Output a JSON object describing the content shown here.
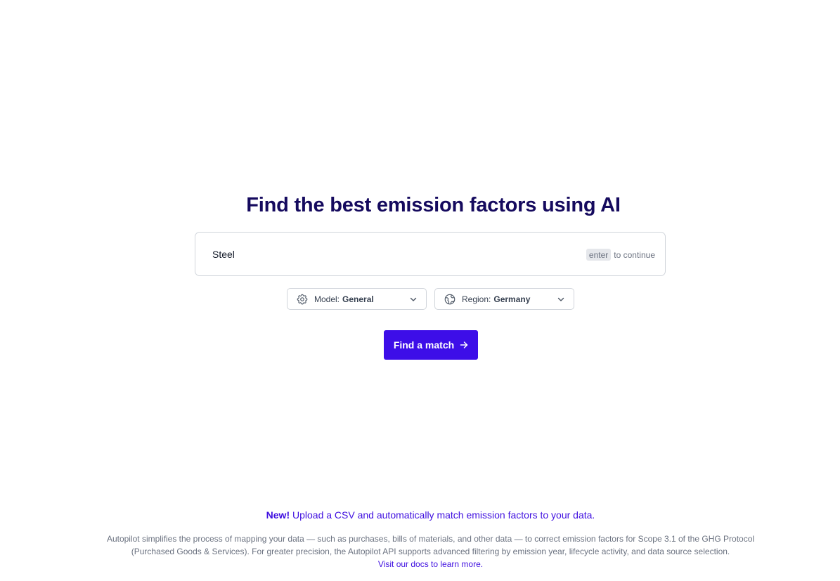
{
  "hero": {
    "title": "Find the best emission factors using AI"
  },
  "search": {
    "value": "Steel",
    "hint_key": "enter",
    "hint_text": "to continue"
  },
  "filters": {
    "model": {
      "label": "Model:",
      "value": "General",
      "icon": "gear-icon"
    },
    "region": {
      "label": "Region:",
      "value": "Germany",
      "icon": "globe-icon"
    }
  },
  "cta": {
    "label": "Find a match",
    "icon": "arrow-right-icon",
    "color": "#3d0ee8"
  },
  "banner": {
    "tag": "New!",
    "text": "Upload a CSV and automatically match emission factors to your data."
  },
  "footer": {
    "description": "Autopilot simplifies the process of mapping your data — such as purchases, bills of materials, and other data — to correct emission factors for Scope 3.1 of the GHG Protocol (Purchased Goods & Services). For greater precision, the Autopilot API supports advanced filtering by emission year, lifecycle activity, and data source selection.",
    "docs_link": "Visit our docs to learn more."
  },
  "colors": {
    "title": "#150a5e",
    "accent": "#3f0fe0"
  }
}
